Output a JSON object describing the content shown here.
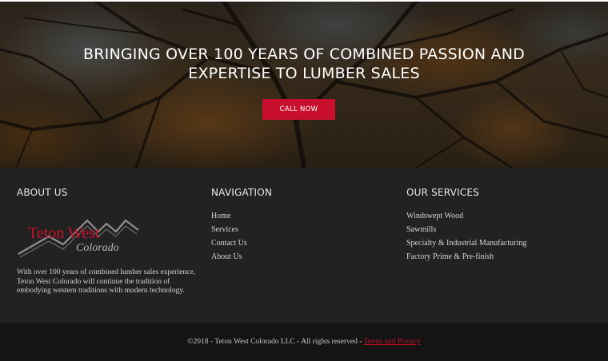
{
  "hero": {
    "title_line1": "BRINGING OVER 100 YEARS OF COMBINED PASSION AND",
    "title_line2": "EXPERTISE TO LUMBER SALES",
    "cta_label": "CALL NOW"
  },
  "about": {
    "heading": "ABOUT US",
    "logo_text_main": "Teton West",
    "logo_text_sub": "Colorado",
    "description": "With over 100 years of combined lumber sales experience, Teton West Colorado will continue the tradition of embodying western traditions with modern technology."
  },
  "navigation": {
    "heading": "NAVIGATION",
    "items": [
      "Home",
      "Services",
      "Contact Us",
      "About Us"
    ]
  },
  "services": {
    "heading": "OUR SERVICES",
    "items": [
      "Windswept Wood",
      "Sawmills",
      "Specialty & Industrial Manufacturing",
      "Factory Prime & Pre-finish"
    ]
  },
  "bottom": {
    "copyright": "©2018 - Teton West Colorado LLC - All rights reserved - ",
    "terms_link": "Terms and Privacy"
  },
  "colors": {
    "accent": "#c8102e",
    "footer_bg": "#222222",
    "bottom_bg": "#141414"
  }
}
